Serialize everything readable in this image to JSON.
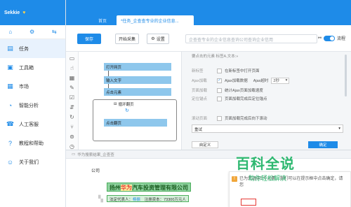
{
  "app": {
    "name": "Sekkie",
    "heart": "♥"
  },
  "sidebar": {
    "items": [
      {
        "label": "任务",
        "icon": "document-icon",
        "active": true
      },
      {
        "label": "工具箱",
        "icon": "toolbox-icon",
        "active": false
      },
      {
        "label": "市场",
        "icon": "market-icon",
        "active": false
      },
      {
        "label": "智能分析",
        "icon": "analysis-icon",
        "active": false
      },
      {
        "label": "人工客服",
        "icon": "support-icon",
        "active": false
      },
      {
        "label": "教程和帮助",
        "icon": "help-icon",
        "active": false
      },
      {
        "label": "关于我们",
        "icon": "about-icon",
        "active": false
      }
    ]
  },
  "tabs": {
    "home": "首页",
    "task": "*任务_企查查专业的企业信息..."
  },
  "toolbar": {
    "save": "保存",
    "start": "开始采集",
    "settings": "设置",
    "url": "企查查专业的企业信息查询公司查询企业信用",
    "flow": "流程"
  },
  "canvas": {
    "nodes": [
      "打开网页",
      "输入文字",
      "点击元素"
    ],
    "loop_title": "循环翻页",
    "loop_node": "点击翻页"
  },
  "panel": {
    "subtitle": "要点击的元素 标签A,文本:»",
    "new_tab_label": "新标签",
    "new_tab_option": "在新标签中打开页面",
    "ajax_label": "Ajax加载",
    "ajax_option": "Ajax加载数据",
    "ajax_timeout_label": "Ajax超时",
    "ajax_timeout_value": "2秒",
    "scroll_label": "页面加载",
    "scroll_option": "统计Ajax页面加载速度",
    "locate_label": "定位锚点",
    "locate_option": "页面加载完成后定位锚点",
    "roll_label": "滚动页面",
    "roll_option": "页面加载完成后向下滚动",
    "retry_value": "重试",
    "custom": "自定义",
    "confirm": "确定"
  },
  "preview": {
    "tab": "华为搜索结果_企查查",
    "section": "公司",
    "company_pre": "扬州",
    "company_highlight": "华为",
    "company_post": "汽车投资管理有限公司",
    "legal_label": "法定代表人：",
    "legal_value": "杨振",
    "capital_label": "注册资本：",
    "capital_value": "73300万元人",
    "popup_text": "已为您选中1个元素，我们可以在提示框中点击确定，请您"
  },
  "watermark": {
    "big": "百科全说",
    "small": "助你轻松解决"
  }
}
